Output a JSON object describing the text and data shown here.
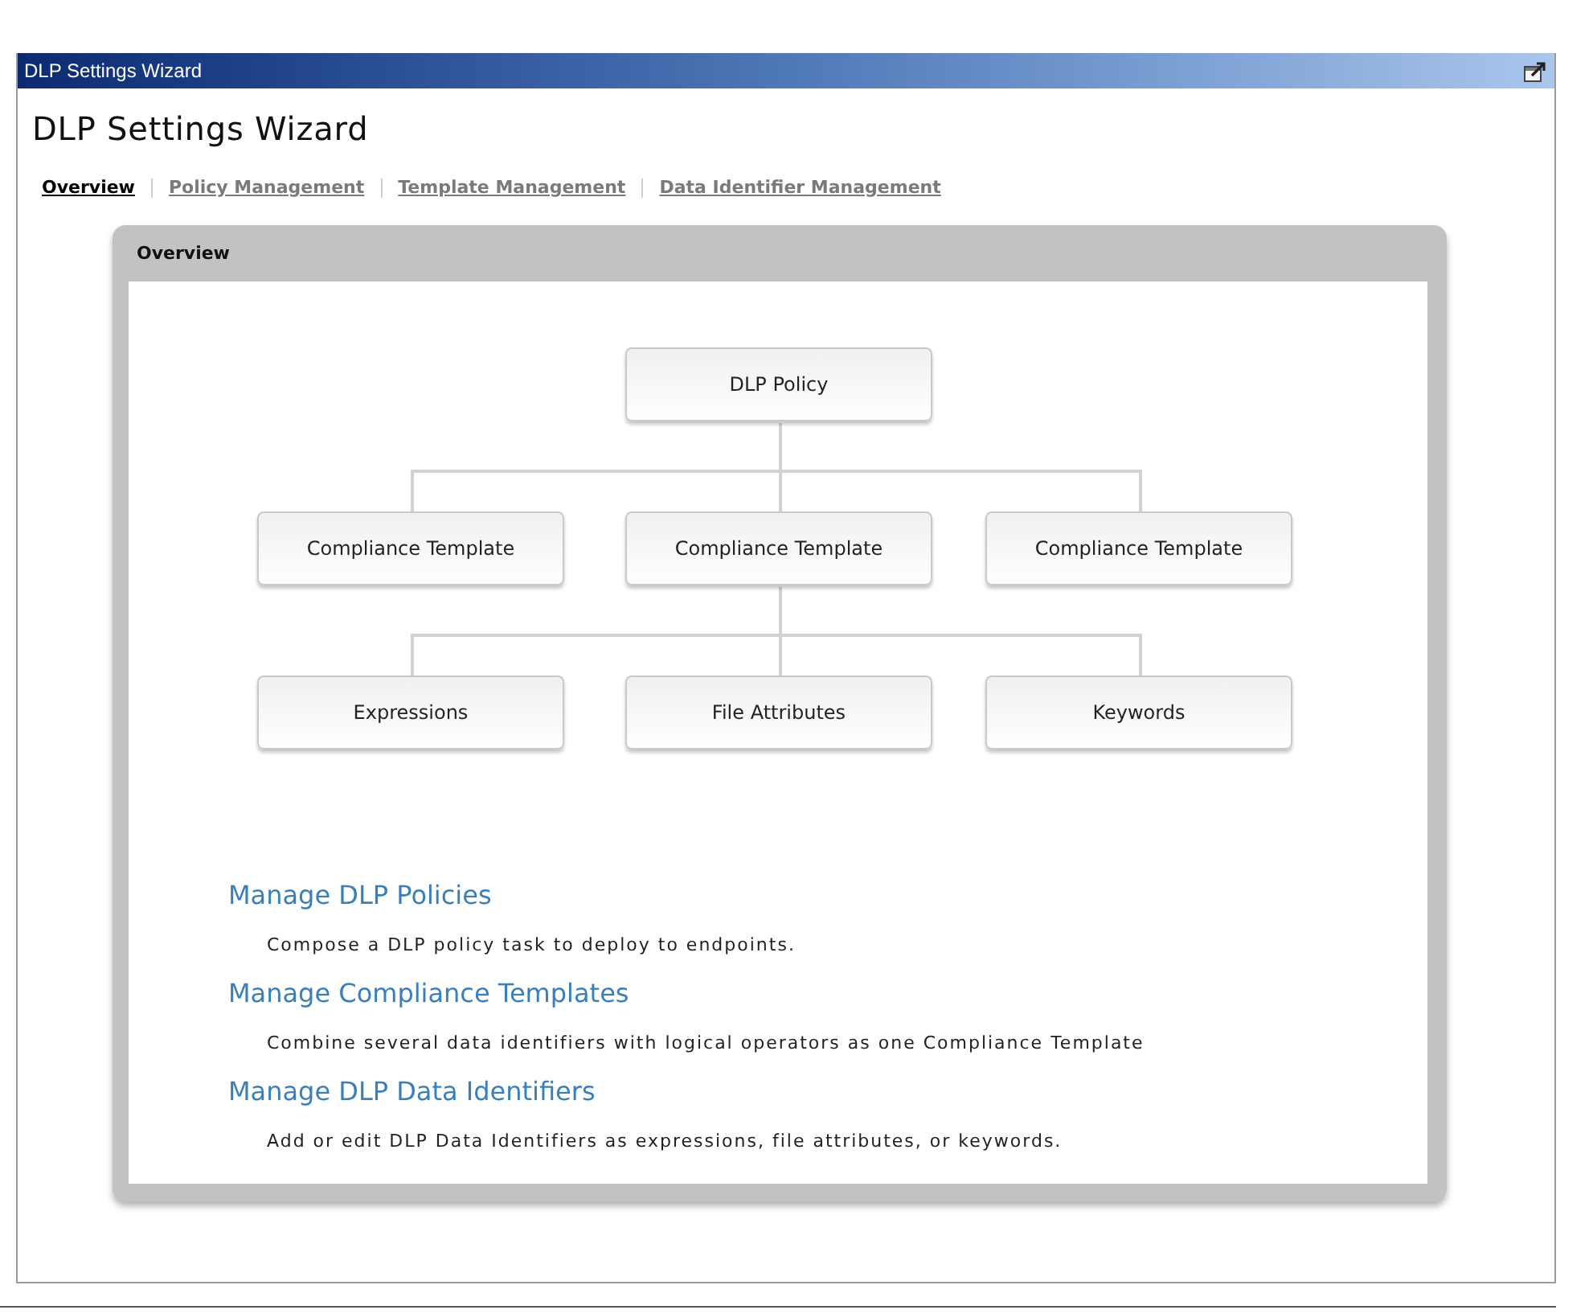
{
  "window": {
    "title": "DLP Settings Wizard"
  },
  "heading": "DLP Settings Wizard",
  "tabs": [
    {
      "label": "Overview",
      "selected": true
    },
    {
      "label": "Policy Management",
      "selected": false
    },
    {
      "label": "Template Management",
      "selected": false
    },
    {
      "label": "Data Identifier Management",
      "selected": false
    }
  ],
  "panel": {
    "title": "Overview",
    "diagram": {
      "label": "DLP Policy",
      "children": [
        {
          "label": "Compliance Template"
        },
        {
          "label": "Compliance Template",
          "children": [
            {
              "label": "Expressions"
            },
            {
              "label": "File Attributes"
            },
            {
              "label": "Keywords"
            }
          ]
        },
        {
          "label": "Compliance Template"
        }
      ]
    },
    "sections": [
      {
        "title": "Manage DLP Policies",
        "description": "Compose a DLP policy task to deploy to endpoints."
      },
      {
        "title": "Manage Compliance Templates",
        "description": "Combine several data identifiers with logical operators as one Compliance Template"
      },
      {
        "title": "Manage DLP Data Identifiers",
        "description": "Add or edit DLP Data Identifiers as expressions, file attributes, or keywords."
      }
    ]
  }
}
